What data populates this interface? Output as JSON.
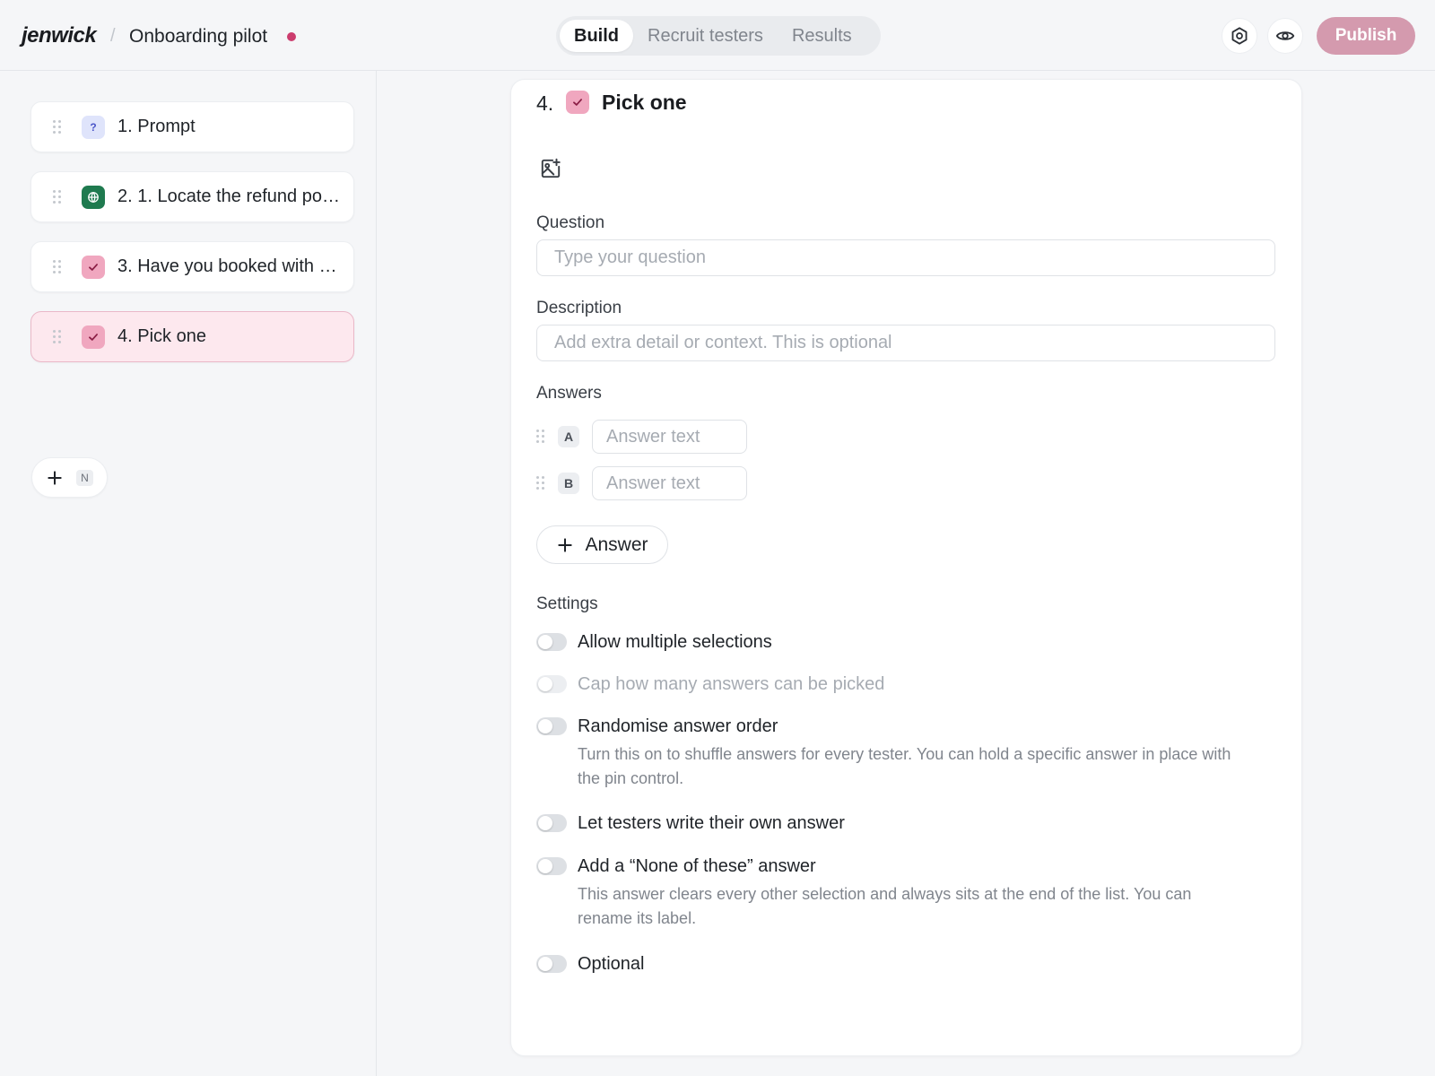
{
  "header": {
    "brand": "jenwick",
    "separator": "/",
    "project_title": "Onboarding pilot",
    "tabs": [
      {
        "label": "Build",
        "active": true
      },
      {
        "label": "Recruit testers",
        "active": false
      },
      {
        "label": "Results",
        "active": false
      }
    ],
    "settings_icon": "settings-icon",
    "preview_icon": "eye-icon",
    "publish_label": "Publish",
    "accent_color": "#cc3d6e",
    "publish_color": "#d49aae"
  },
  "sidebar": {
    "steps": [
      {
        "label": "1. Prompt",
        "icon": "question-icon",
        "icon_glyph": "?",
        "selected": false
      },
      {
        "label": "2. 1. Locate the refund poli...",
        "icon": "globe-icon",
        "selected": false
      },
      {
        "label": "3. Have you booked with u...",
        "icon": "check-icon",
        "selected": false
      },
      {
        "label": "4. Pick one",
        "icon": "check-icon",
        "selected": true
      }
    ],
    "add_step_shortcut": "N"
  },
  "editor": {
    "step_number": "4.",
    "step_title": "Pick one",
    "question": {
      "label": "Question",
      "value": "",
      "placeholder": "Type your question"
    },
    "description": {
      "label": "Description",
      "value": "",
      "placeholder": "Add extra detail or context. This is optional"
    },
    "answers": {
      "label": "Answers",
      "items": [
        {
          "letter": "A",
          "value": "",
          "placeholder": "Answer text"
        },
        {
          "letter": "B",
          "value": "",
          "placeholder": "Answer text"
        }
      ],
      "add_label": "Answer"
    },
    "settings": {
      "label": "Settings",
      "toggles": [
        {
          "label": "Allow multiple selections",
          "on": false,
          "disabled": false,
          "help": ""
        },
        {
          "label": "Cap how many answers can be picked",
          "on": false,
          "disabled": true,
          "help": ""
        },
        {
          "label": "Randomise answer order",
          "on": false,
          "disabled": false,
          "help": "Turn this on to shuffle answers for every tester. You can hold a specific answer in place with the pin control."
        },
        {
          "label": "Let testers write their own answer",
          "on": false,
          "disabled": false,
          "help": ""
        },
        {
          "label": "Add a “None of these” answer",
          "on": false,
          "disabled": false,
          "help": "This answer clears every other selection and always sits at the end of the list. You can rename its label."
        },
        {
          "label": "Optional",
          "on": false,
          "disabled": false,
          "help": ""
        }
      ]
    }
  }
}
